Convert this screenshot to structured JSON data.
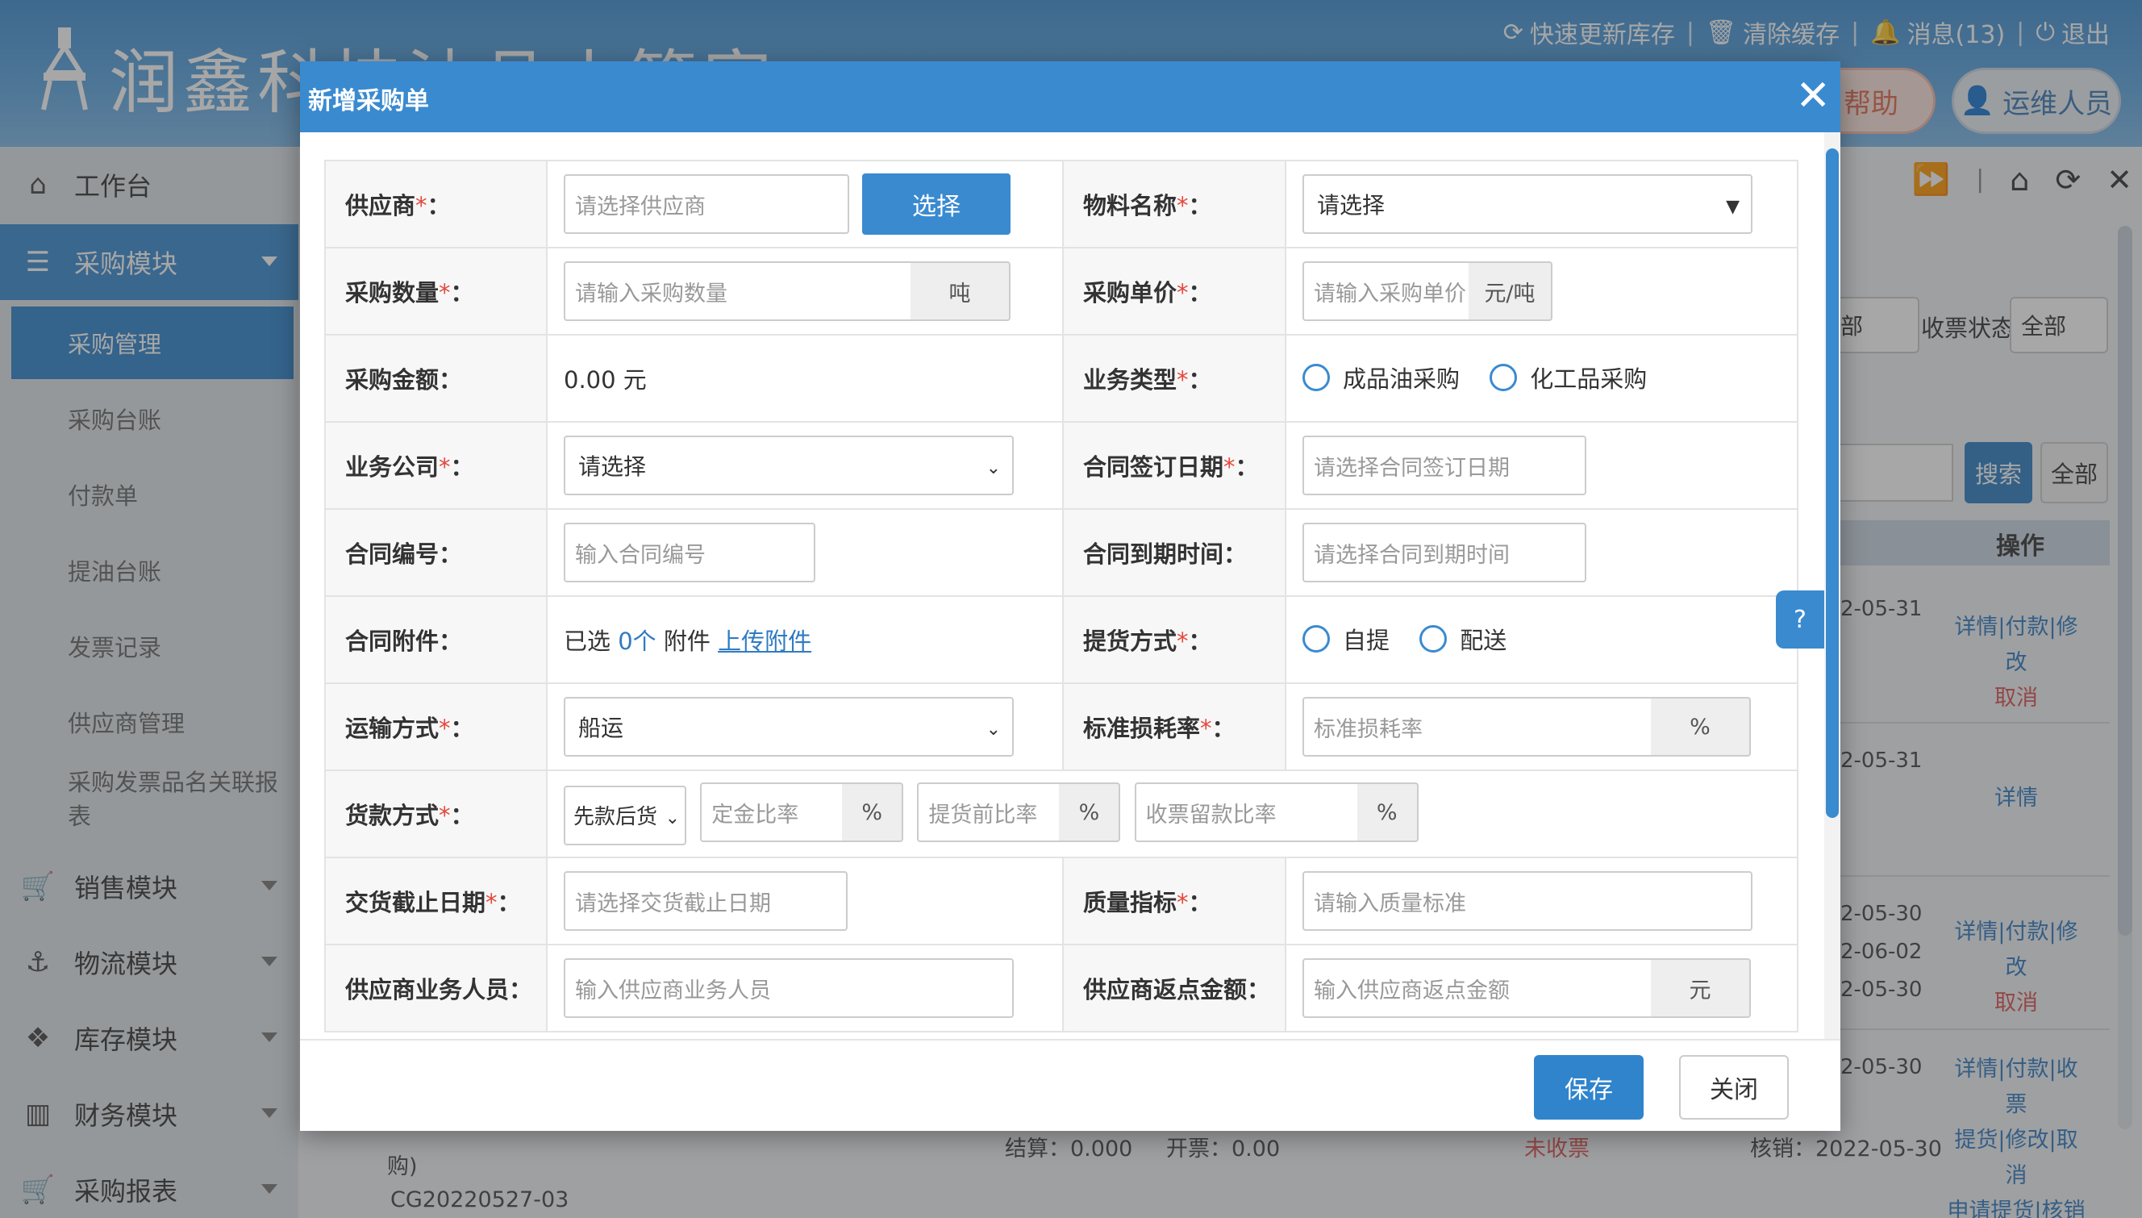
{
  "app": {
    "title": "润鑫科技油品小管家",
    "top_links": {
      "refresh": "快速更新库存",
      "clear_cache": "清除缓存",
      "messages": "消息(13)",
      "logout": "退出"
    },
    "help": "帮助",
    "user": "运维人员"
  },
  "sidebar": {
    "workbench": "工作台",
    "purchase_module": "采购模块",
    "purchase_sub": [
      "采购管理",
      "采购台账",
      "付款单",
      "提油台账",
      "发票记录",
      "供应商管理",
      "采购发票品名关联报表"
    ],
    "sales_module": "销售模块",
    "logistics_module": "物流模块",
    "inventory_module": "库存模块",
    "finance_module": "财务模块",
    "purchase_report": "采购报表"
  },
  "background": {
    "filter_sel1": "部",
    "filter_label": "收票状态",
    "filter_sel2": "全部",
    "search_btn": "搜索",
    "all_btn": "全部",
    "col_op": "操作",
    "rows": [
      {
        "dates": [
          "2-05-31"
        ],
        "ops": "详情|付款|修改",
        "ops2": "取消"
      },
      {
        "dates": [
          "2-05-31"
        ],
        "ops": "详情",
        "ops2": ""
      },
      {
        "dates": [
          "2-05-30",
          "2-06-02",
          "2-05-30"
        ],
        "ops": "详情|付款|修改",
        "ops2": "取消"
      },
      {
        "dates": [
          "2-05-30"
        ],
        "ops": "详情|付款|收票",
        "ops2": "提货|修改|取消",
        "ops3": "申请提货|核销"
      }
    ],
    "bottom": {
      "purchase": "购)",
      "order_no": "CG20220527-03",
      "settle": "结算：0.000",
      "invoice": "开票：0.00",
      "status": "未收票",
      "verify": "核销：2022-05-30"
    }
  },
  "modal": {
    "title": "新增采购单",
    "save": "保存",
    "close": "关闭",
    "form": {
      "supplier": {
        "label": "供应商",
        "placeholder": "请选择供应商",
        "button": "选择"
      },
      "material": {
        "label": "物料名称",
        "value": "请选择"
      },
      "qty": {
        "label": "采购数量",
        "placeholder": "请输入采购数量",
        "unit": "吨"
      },
      "price": {
        "label": "采购单价",
        "placeholder": "请输入采购单价",
        "unit": "元/吨"
      },
      "amount": {
        "label": "采购金额：",
        "value": "0.00 元"
      },
      "biz_type": {
        "label": "业务类型",
        "options": [
          "成品油采购",
          "化工品采购"
        ]
      },
      "company": {
        "label": "业务公司",
        "value": "请选择"
      },
      "sign_date": {
        "label": "合同签订日期",
        "placeholder": "请选择合同签订日期"
      },
      "contract_no": {
        "label": "合同编号：",
        "placeholder": "输入合同编号"
      },
      "expire": {
        "label": "合同到期时间：",
        "placeholder": "请选择合同到期时间"
      },
      "attach": {
        "label": "合同附件：",
        "prefix": "已选",
        "count": "0个",
        "suffix": "附件",
        "upload": "上传附件"
      },
      "pickup": {
        "label": "提货方式",
        "options": [
          "自提",
          "配送"
        ]
      },
      "transport": {
        "label": "运输方式",
        "value": "船运"
      },
      "loss": {
        "label": "标准损耗率",
        "placeholder": "标准损耗率",
        "unit": "%"
      },
      "payment": {
        "label": "货款方式",
        "value": "先款后货",
        "p1": "定金比率",
        "p2": "提货前比率",
        "p3": "收票留款比率",
        "unit": "%"
      },
      "deadline": {
        "label": "交货截止日期",
        "placeholder": "请选择交货截止日期"
      },
      "quality": {
        "label": "质量指标",
        "placeholder": "请输入质量标准"
      },
      "sup_staff": {
        "label": "供应商业务人员：",
        "placeholder": "输入供应商业务人员"
      },
      "rebate": {
        "label": "供应商返点金额：",
        "placeholder": "输入供应商返点金额",
        "unit": "元"
      }
    }
  },
  "colors": {
    "primary": "#3a8ad0",
    "required": "#e5483c",
    "link": "#2f7bc2",
    "danger": "#d9534f"
  }
}
